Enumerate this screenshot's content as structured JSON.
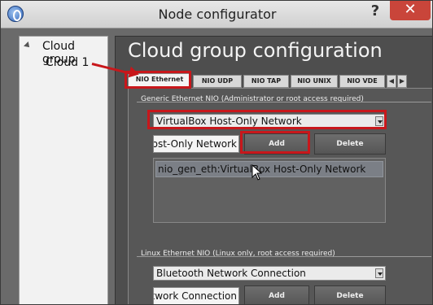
{
  "window": {
    "title": "Node configurator",
    "help_glyph": "?",
    "close_glyph": "✕"
  },
  "tree": {
    "root_label": "Cloud group",
    "child_label": "Cloud 1"
  },
  "panel": {
    "title": "Cloud group configuration"
  },
  "tabs": [
    {
      "label": "NIO Ethernet",
      "active": true
    },
    {
      "label": "NIO UDP",
      "active": false
    },
    {
      "label": "NIO TAP",
      "active": false
    },
    {
      "label": "NIO UNIX",
      "active": false
    },
    {
      "label": "NIO VDE",
      "active": false
    }
  ],
  "tab_scroll": {
    "left": "◀",
    "right": "▶"
  },
  "generic": {
    "label": "Generic Ethernet NIO (Administrator or root access required)",
    "selected_adapter": "VirtualBox Host-Only Network",
    "name_field": "VirtualBox Host-Only Network",
    "add_label": "Add",
    "delete_label": "Delete",
    "items": [
      "nio_gen_eth:VirtualBox Host-Only Network"
    ]
  },
  "linux": {
    "label": "Linux Ethernet NIO (Linux only, root access required)",
    "selected_adapter": "Bluetooth Network Connection",
    "name_field": "Bluetooth Network Connection",
    "add_label": "Add",
    "delete_label": "Delete"
  },
  "colors": {
    "highlight": "#c8171b",
    "panel_bg": "#4e4e4e"
  }
}
